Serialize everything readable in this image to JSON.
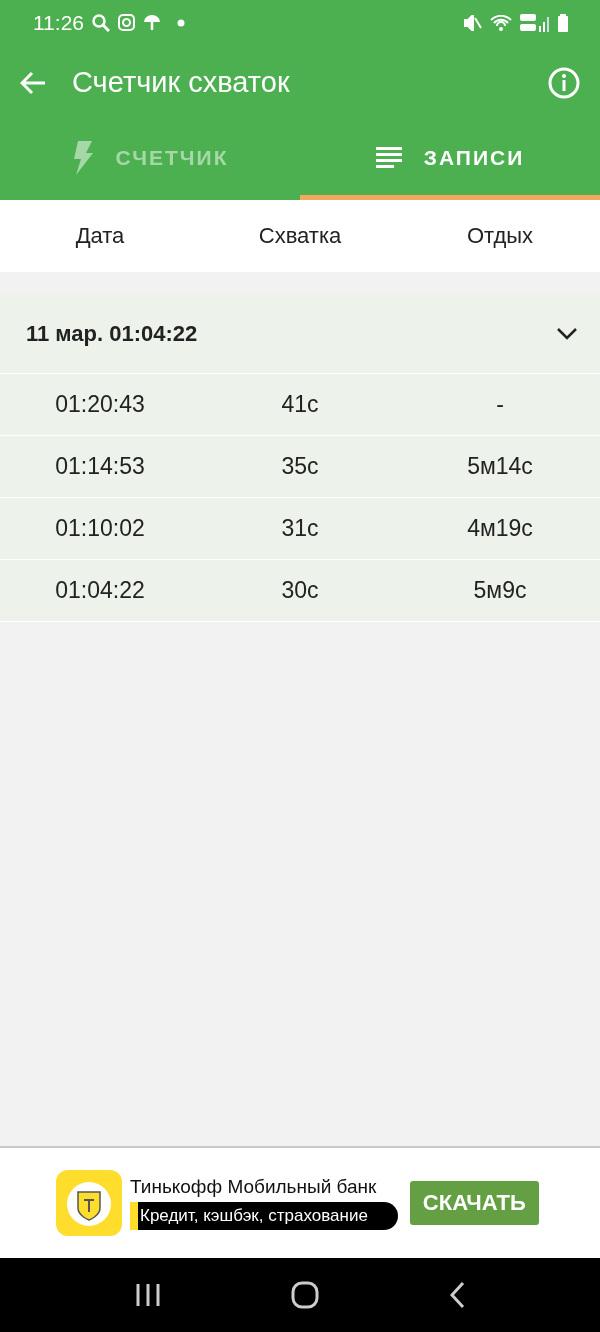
{
  "status_bar": {
    "time": "11:26"
  },
  "app_bar": {
    "title": "Счетчик схваток"
  },
  "tabs": [
    {
      "label": "СЧЕТЧИК",
      "kind": "counter",
      "selected": false
    },
    {
      "label": "ЗАПИСИ",
      "kind": "records",
      "selected": true
    }
  ],
  "table": {
    "columns": [
      "Дата",
      "Схватка",
      "Отдых"
    ],
    "groups": [
      {
        "title": "11 мар. 01:04:22",
        "expanded": true,
        "rows": [
          {
            "date": "01:20:43",
            "contraction": "41с",
            "rest": "-"
          },
          {
            "date": "01:14:53",
            "contraction": "35с",
            "rest": "5м14с"
          },
          {
            "date": "01:10:02",
            "contraction": "31с",
            "rest": "4м19с"
          },
          {
            "date": "01:04:22",
            "contraction": "30с",
            "rest": "5м9с"
          }
        ]
      }
    ]
  },
  "ad": {
    "title": "Тинькофф Мобильный банк",
    "subtitle": "Кредит, кэшбэк, страхование",
    "button": "СКАЧАТЬ"
  }
}
